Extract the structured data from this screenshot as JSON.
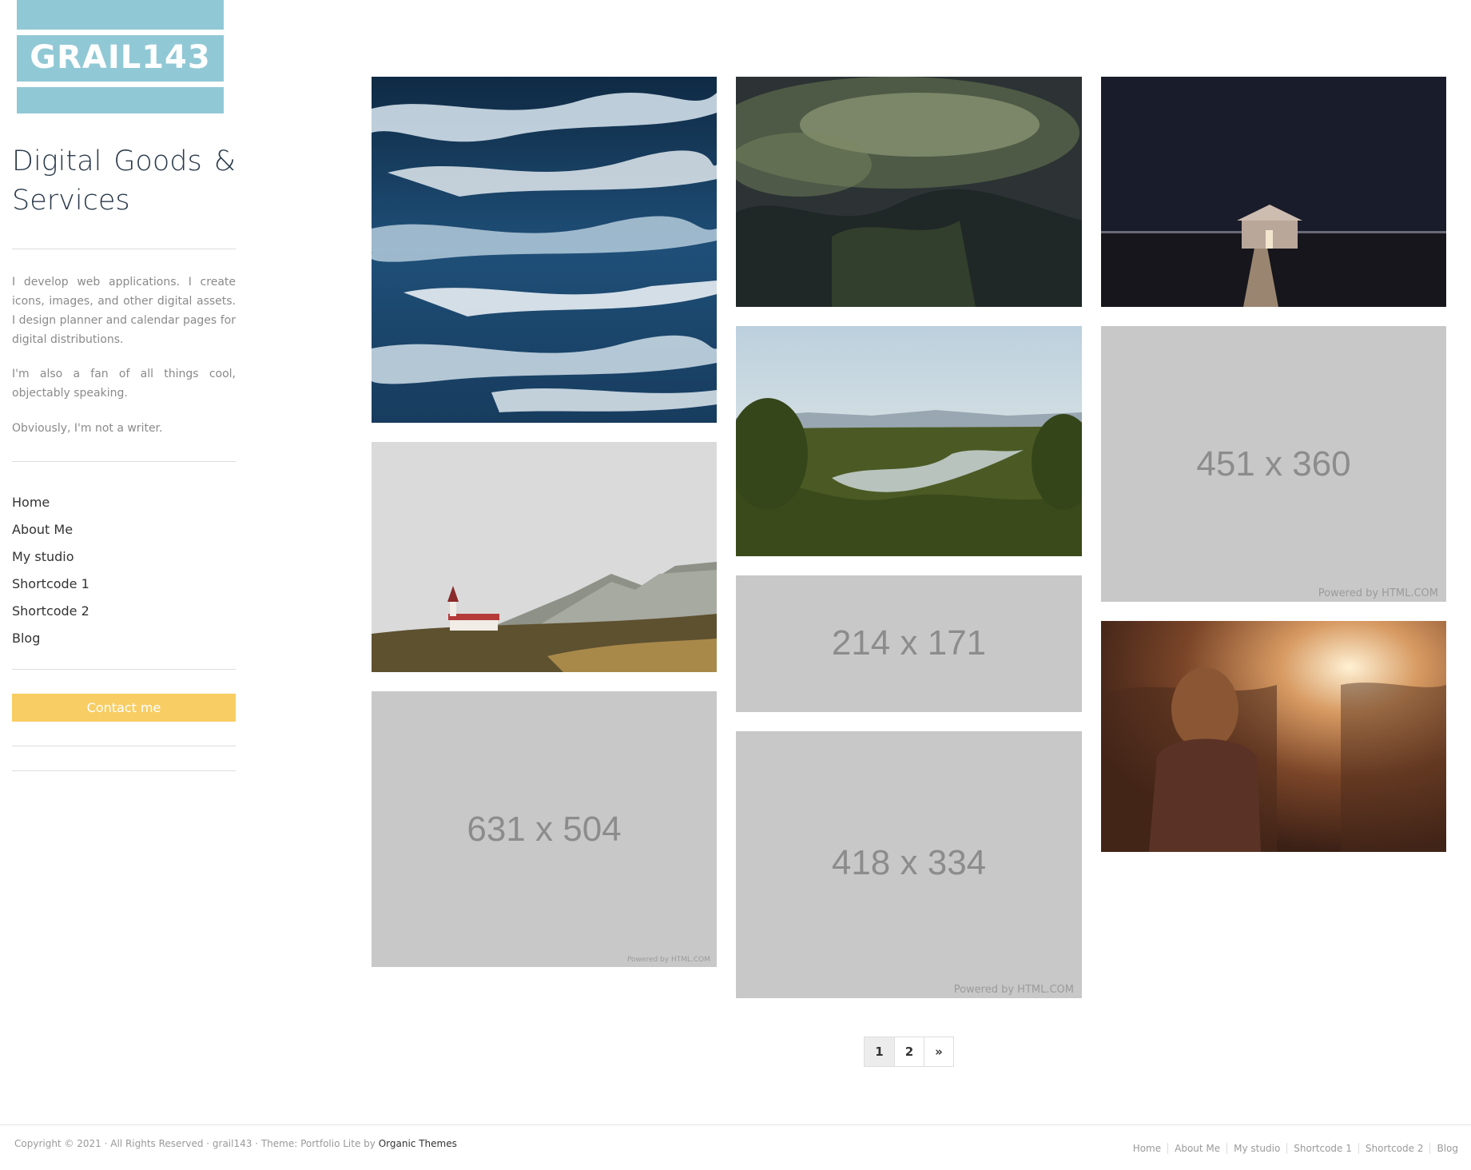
{
  "colors": {
    "logo_bg": "#91c8d5",
    "button_bg": "#f8cd63",
    "placeholder_bg": "#c8c8c8",
    "title_text": "#2b3a4a"
  },
  "logo": {
    "text": "GRAIL143"
  },
  "site": {
    "title": "Digital Goods & Services",
    "description": [
      "I develop web applications. I create icons, images, and other digital assets. I design planner and calendar pages for digital distributions.",
      "I'm also a fan of all things cool, objectably speaking.",
      "Obviously, I'm not a writer."
    ]
  },
  "nav": {
    "items": [
      "Home",
      "About Me",
      "My studio",
      "Shortcode 1",
      "Shortcode 2",
      "Blog"
    ]
  },
  "contact_button": "Contact me",
  "gallery": {
    "photos": [
      {
        "subject": "blue abstract paint strokes"
      },
      {
        "subject": "misty forest hills"
      },
      {
        "subject": "boathouse on pier at night"
      },
      {
        "subject": "church on hillside with mountains"
      },
      {
        "subject": "jungle valley with river at sunrise"
      },
      {
        "subject": "woman in sunset field"
      }
    ],
    "placeholders": [
      {
        "label": "451 x 360",
        "credit": "Powered by HTML.COM"
      },
      {
        "label": "214 x 171"
      },
      {
        "label": "631 x 504",
        "credit": "Powered by HTML.COM"
      },
      {
        "label": "418 x 334",
        "credit": "Powered by HTML.COM"
      }
    ]
  },
  "pagination": {
    "pages": [
      "1",
      "2"
    ],
    "next": "»",
    "current": "1"
  },
  "footer": {
    "copyright": "Copyright © 2021 · All Rights Reserved · grail143 · Theme: Portfolio Lite by ",
    "theme_author": "Organic Themes",
    "nav": [
      "Home",
      "About Me",
      "My studio",
      "Shortcode 1",
      "Shortcode 2",
      "Blog"
    ]
  }
}
